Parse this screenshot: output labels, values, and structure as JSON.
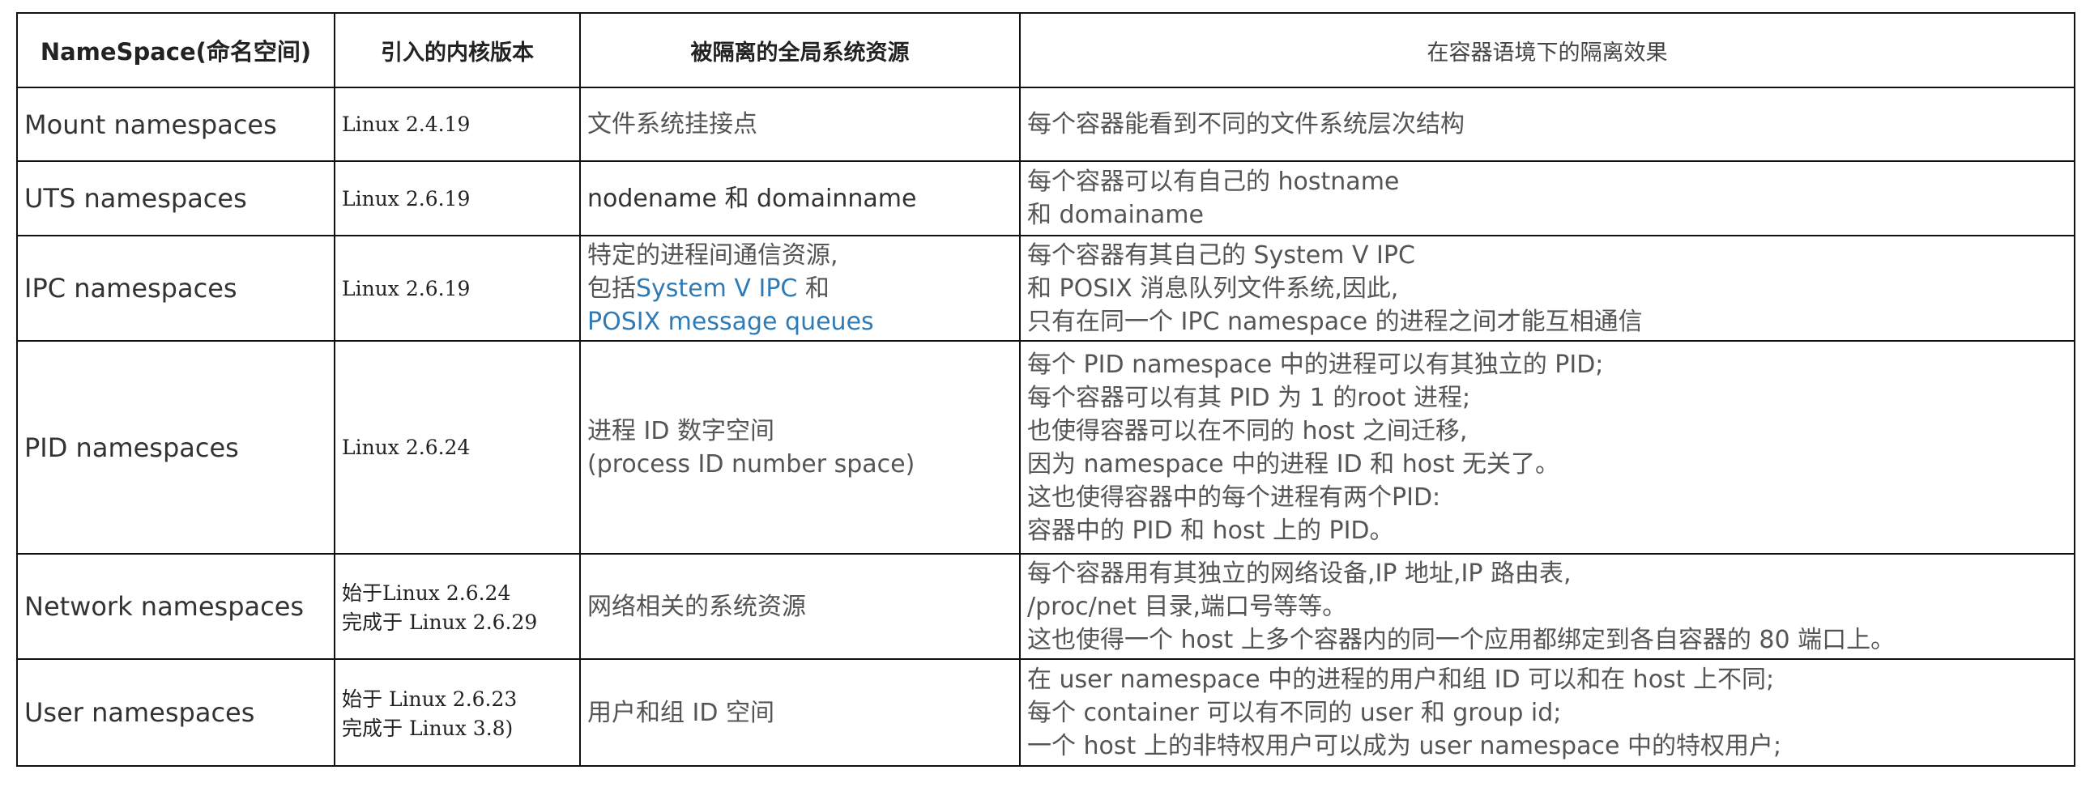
{
  "headers": {
    "namespace": "NameSpace(命名空间)",
    "kernel": "引入的内核版本",
    "resource": "被隔离的全局系统资源",
    "effect": "在容器语境下的隔离效果"
  },
  "rows": [
    {
      "name": "Mount namespaces",
      "kernel": [
        "Linux 2.4.19"
      ],
      "resource": [
        "文件系统挂接点"
      ],
      "effect": [
        "每个容器能看到不同的文件系统层次结构"
      ]
    },
    {
      "name": "UTS namespaces",
      "kernel": [
        "Linux 2.6.19"
      ],
      "resource": [
        "nodename 和 domainname"
      ],
      "effect": [
        "每个容器可以有自己的 hostname",
        "和 domainame"
      ]
    },
    {
      "name": "IPC namespaces",
      "kernel": [
        "Linux 2.6.19"
      ],
      "resource": [
        "特定的进程间通信资源,",
        "包括",
        "System V IPC",
        " 和",
        " POSIX message queues"
      ],
      "effect": [
        "每个容器有其自己的 System V IPC",
        "和 POSIX 消息队列文件系统,因此,",
        "只有在同一个 IPC namespace 的进程之间才能互相通信"
      ]
    },
    {
      "name": "PID namespaces",
      "kernel": [
        "Linux 2.6.24"
      ],
      "resource": [
        "进程 ID 数字空间",
        "(process ID number space)"
      ],
      "effect": [
        "每个 PID namespace 中的进程可以有其独立的 PID;",
        " 每个容器可以有其 PID 为 1 的root 进程;",
        "也使得容器可以在不同的 host 之间迁移,",
        "因为 namespace 中的进程 ID 和 host 无关了。",
        "这也使得容器中的每个进程有两个PID:",
        "容器中的 PID 和 host 上的 PID。"
      ]
    },
    {
      "name": "Network namespaces",
      "kernel": [
        "始于Linux 2.6.24",
        "完成于 Linux 2.6.29"
      ],
      "resource": [
        "网络相关的系统资源"
      ],
      "effect": [
        "每个容器用有其独立的网络设备,IP 地址,IP 路由表,",
        "/proc/net 目录,端口号等等。",
        "这也使得一个 host 上多个容器内的同一个应用都绑定到各自容器的 80 端口上。"
      ]
    },
    {
      "name": "User namespaces",
      "kernel": [
        "始于 Linux 2.6.23",
        "完成于 Linux 3.8)"
      ],
      "resource": [
        "用户和组 ID 空间"
      ],
      "effect": [
        " 在 user namespace 中的进程的用户和组 ID 可以和在 host 上不同;",
        "每个 container 可以有不同的 user 和 group id;",
        "一个 host 上的非特权用户可以成为 user namespace 中的特权用户;"
      ]
    }
  ]
}
